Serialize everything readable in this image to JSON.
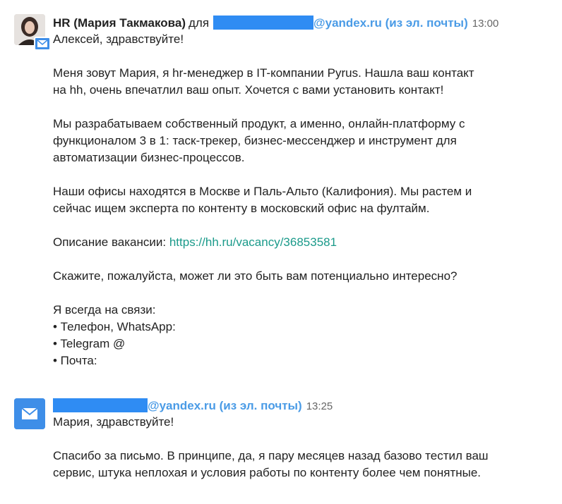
{
  "messages": [
    {
      "sender": "HR (Мария Такмакова)",
      "for_word": "для",
      "email_suffix": "@yandex.ru (из эл. почты)",
      "time": "13:00",
      "greeting": "Алексей, здравствуйте!",
      "para1_line1": "Меня зовут Мария, я hr-менеджер в IT-компании Pyrus. Нашла ваш контакт",
      "para1_line2": "на hh, очень впечатлил ваш опыт. Хочется с вами установить контакт!",
      "para2_line1": "Мы разрабатываем собственный продукт, а именно, онлайн-платформу с",
      "para2_line2": "функционалом 3 в 1: таск-трекер, бизнес-мессенджер и инструмент для",
      "para2_line3": "автоматизации бизнес-процессов.",
      "para3_line1": "Наши офисы находятся в Москве и Паль-Альто (Калифония). Мы растем и",
      "para3_line2": "сейчас ищем эксперта по контенту в московский офис на фултайм.",
      "vacancy_label": "Описание вакансии: ",
      "vacancy_link": "https://hh.ru/vacancy/36853581",
      "question": "Скажите, пожалуйста, может ли это быть вам потенциально интересно?",
      "contacts_title": "Я всегда на связи:",
      "contact_phone": "• Телефон, WhatsApp:",
      "contact_telegram": "• Telegram @",
      "contact_email": "• Почта:"
    },
    {
      "email_suffix": "@yandex.ru (из эл. почты)",
      "time": "13:25",
      "greeting": "Мария, здравствуйте!",
      "para1_line1": "Спасибо за письмо. В принципе, да, я пару месяцев назад базово тестил ваш",
      "para1_line2": "сервис, штука неплохая и условия работы по контенту более чем понятные."
    }
  ]
}
